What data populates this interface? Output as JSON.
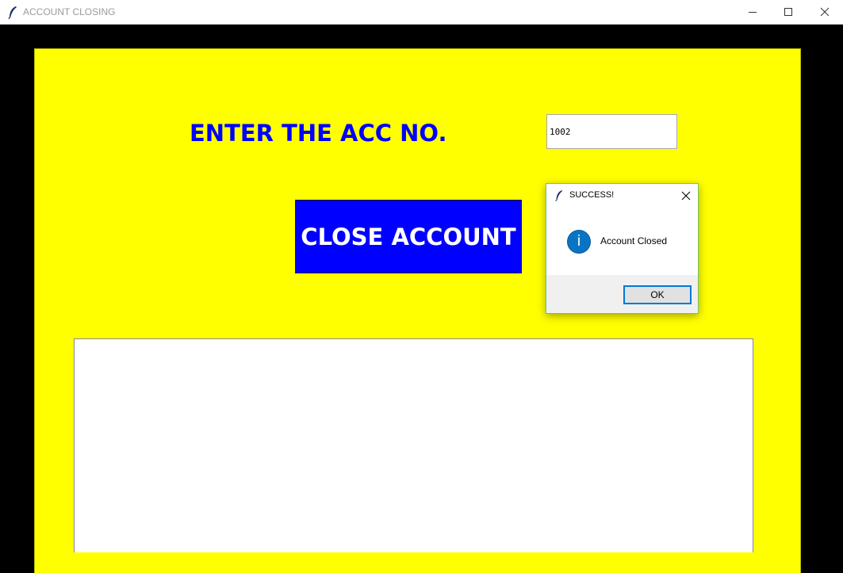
{
  "window": {
    "title": "ACCOUNT CLOSING",
    "app_icon": "tk-feather-icon"
  },
  "form": {
    "label": "ENTER THE ACC NO.",
    "account_number": "1002",
    "close_button_label": "CLOSE ACCOUNT"
  },
  "output": {
    "text": ""
  },
  "dialog": {
    "title": "SUCCESS!",
    "message": "Account Closed",
    "icon": "info-icon",
    "ok_label": "OK"
  },
  "colors": {
    "panel_background": "#ffff00",
    "label_text": "#0000ff",
    "button_background": "#0000ff",
    "button_text": "#ffffff",
    "window_background": "#000000"
  }
}
